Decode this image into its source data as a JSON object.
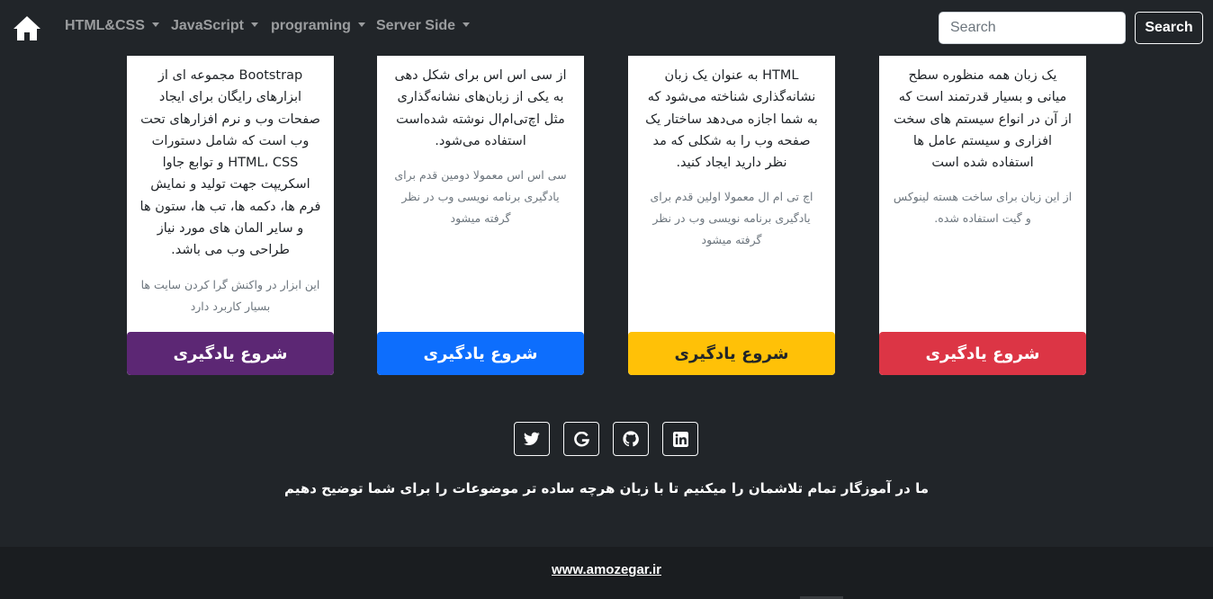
{
  "nav": {
    "home_icon": "home-icon",
    "items": [
      {
        "label": "HTML&CSS"
      },
      {
        "label": "JavaScript"
      },
      {
        "label": "programing"
      },
      {
        "label": "Server Side"
      }
    ],
    "search_placeholder": "Search",
    "search_button": "Search"
  },
  "cards": [
    {
      "text": "Bootstrap مجموعه ای از ابزارهای رایگان برای ایجاد صفحات وب و نرم افزارهای تحت وب است که شامل دستورات HTML، CSS و توابع جاوا اسکریپت جهت تولید و نمایش فرم ها، دکمه ها، تب ها، ستون ها و سایر المان های مورد نیاز طراحی وب می باشد.",
      "sub": "این ابزار در واکنش گرا کردن سایت ها بسیار کاربرد دارد",
      "button": "شروع یادگیری",
      "color": "#5c2774",
      "text_color": "#ffffff"
    },
    {
      "text": "از سی اس اس برای شکل دهی به یکی از زبان‌های نشانه‌گذاری مثل اچ‌تی‌ام‌ال نوشته شده‌است استفاده می‌شود.",
      "sub": "سی اس اس معمولا دومین قدم برای یادگیری برنامه نویسی وب در نظر گرفته میشود",
      "button": "شروع یادگیری",
      "color": "#0d6efd",
      "text_color": "#ffffff"
    },
    {
      "text": "HTML به عنوان یک زبان نشانه‌گذاری شناخته می‌شود که به شما اجازه می‌دهد ساختار یک صفحه وب را به شکلی که مد نظر دارید ایجاد کنید.",
      "sub": "اچ تی ام ال معمولا اولین قدم برای یادگیری برنامه نویسی وب در نظر گرفته میشود",
      "button": "شروع یادگیری",
      "color": "#ffc107",
      "text_color": "#212529"
    },
    {
      "text": "یک زبان همه منظوره سطح میانی و بسیار قدرتمند است که از آن در انواع سیستم های سخت افزاری و سیستم عامل ها استفاده شده است",
      "sub": "از این زبان برای ساخت هسته لینوکس و گیت استفاده شده.",
      "button": "شروع یادگیری",
      "color": "#dc3545",
      "text_color": "#ffffff"
    }
  ],
  "social_icons": [
    "twitter-icon",
    "google-icon",
    "github-icon",
    "linkedin-icon"
  ],
  "footer": {
    "text": "ما در آموزگار تمام تلاشمان را میکنیم تا با زبان هرچه ساده تر موضوعات را برای شما توضیح دهیم",
    "link": "www.amozegar.ir"
  }
}
